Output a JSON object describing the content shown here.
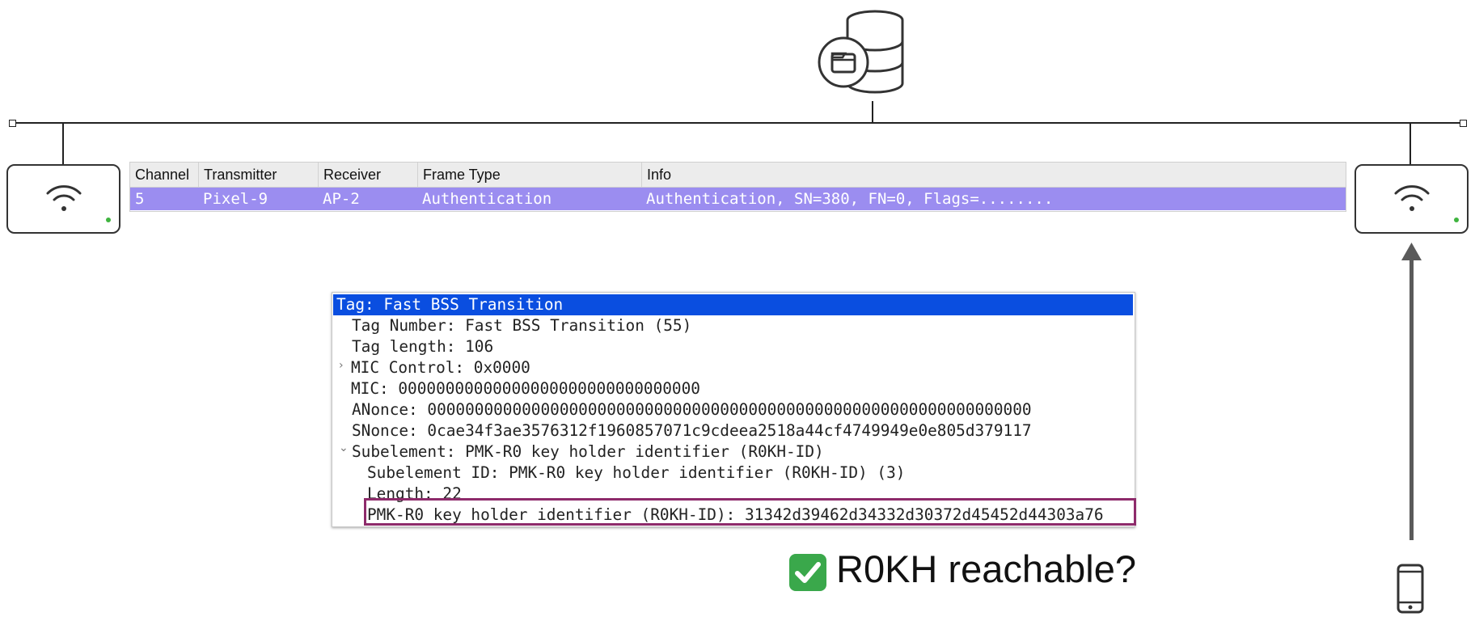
{
  "packet_list": {
    "columns": [
      "Channel",
      "Transmitter",
      "Receiver",
      "Frame Type",
      "Info"
    ],
    "selected_row": {
      "channel": "5",
      "transmitter": "Pixel-9",
      "receiver": "AP-2",
      "frame_type": "Authentication",
      "info": "Authentication, SN=380, FN=0, Flags=........"
    },
    "row_color": "#9b8df0"
  },
  "detail": {
    "lines": [
      "Tag: Fast BSS Transition",
      "Tag Number: Fast BSS Transition (55)",
      "Tag length: 106",
      "MIC Control: 0x0000",
      "MIC: 00000000000000000000000000000000",
      "ANonce: 0000000000000000000000000000000000000000000000000000000000000000",
      "SNonce: 0cae34f3ae3576312f1960857071c9cdeea2518a44cf4749949e0e805d379117",
      "Subelement: PMK-R0 key holder identifier (R0KH-ID)",
      "Subelement ID: PMK-R0 key holder identifier (R0KH-ID) (3)",
      "Length: 22",
      "PMK-R0 key holder identifier (R0KH-ID): 31342d39462d34332d30372d45452d44303a76"
    ],
    "selected_color": "#0a4ee0",
    "highlight_color": "#8e2b6b"
  },
  "annotation": {
    "label": "R0KH reachable?",
    "check_color": "#3aa84b"
  },
  "icons": {
    "server": "database-server-icon",
    "ap": "wifi-access-point-icon",
    "client": "smartphone-icon"
  }
}
